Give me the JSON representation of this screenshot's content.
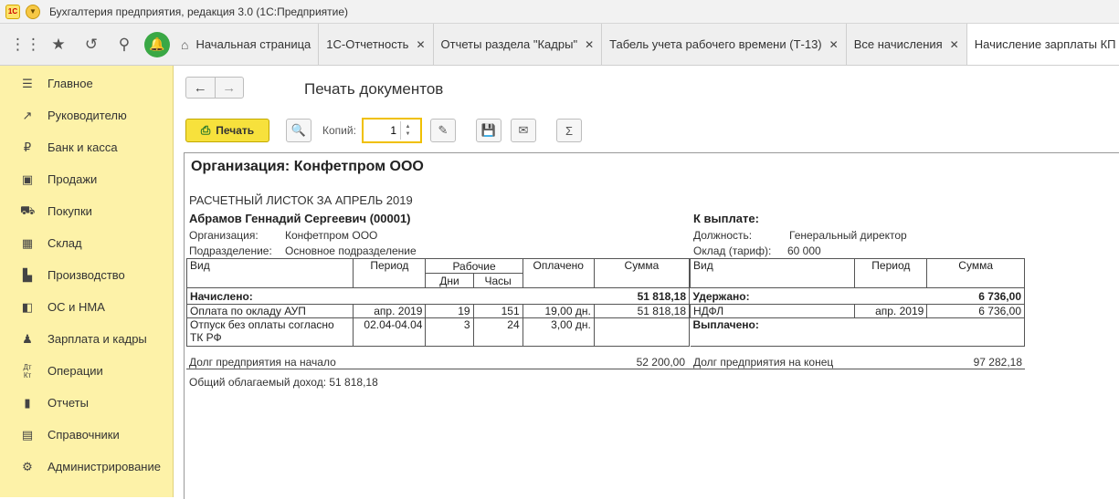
{
  "window": {
    "title": "Бухгалтерия предприятия, редакция 3.0  (1С:Предприятие)",
    "logo_text": "1С"
  },
  "tabs": [
    {
      "label": "Начальная страница",
      "closable": false
    },
    {
      "label": "1С-Отчетность",
      "closable": true
    },
    {
      "label": "Отчеты раздела \"Кадры\"",
      "closable": true
    },
    {
      "label": "Табель учета рабочего времени (Т-13)",
      "closable": true
    },
    {
      "label": "Все начисления",
      "closable": true
    },
    {
      "label": "Начисление зарплаты КП",
      "closable": false
    }
  ],
  "sidebar": {
    "items": [
      {
        "label": "Главное",
        "icon": "menu-icon"
      },
      {
        "label": "Руководителю",
        "icon": "trend-icon"
      },
      {
        "label": "Банк и касса",
        "icon": "ruble-icon"
      },
      {
        "label": "Продажи",
        "icon": "bag-icon"
      },
      {
        "label": "Покупки",
        "icon": "cart-icon"
      },
      {
        "label": "Склад",
        "icon": "warehouse-icon"
      },
      {
        "label": "Производство",
        "icon": "factory-icon"
      },
      {
        "label": "ОС и НМА",
        "icon": "truck-icon"
      },
      {
        "label": "Зарплата и кадры",
        "icon": "person-icon"
      },
      {
        "label": "Операции",
        "icon": "dt-kt-icon"
      },
      {
        "label": "Отчеты",
        "icon": "bar-chart-icon"
      },
      {
        "label": "Справочники",
        "icon": "book-icon"
      },
      {
        "label": "Администрирование",
        "icon": "gear-icon"
      }
    ]
  },
  "page": {
    "title": "Печать документов",
    "print_label": "Печать",
    "copies_label": "Копий:",
    "copies_value": "1"
  },
  "doc": {
    "org": "Организация: Конфетпром ООО",
    "sheet_title": "РАСЧЕТНЫЙ ЛИСТОК ЗА АПРЕЛЬ 2019",
    "employee": "Абрамов Геннадий Сергеевич (00001)",
    "to_pay": "К выплате:",
    "org_label": "Организация:",
    "org_value": "Конфетпром ООО",
    "dept_label": "Подразделение:",
    "dept_value": "Основное подразделение",
    "position_label": "Должность:",
    "position_value": "Генеральный директор",
    "salary_label": "Оклад (тариф):",
    "salary_value": "60 000",
    "headers": {
      "vid": "Вид",
      "period": "Период",
      "working": "Рабочие",
      "days": "Дни",
      "hours": "Часы",
      "paid": "Оплачено",
      "sum": "Сумма",
      "vid2": "Вид",
      "period2": "Период",
      "sum2": "Сумма"
    },
    "accrued_label": "Начислено:",
    "accrued_total": "51 818,18",
    "withheld_label": "Удержано:",
    "withheld_total": "6 736,00",
    "accruals": [
      {
        "name": "Оплата по окладу АУП",
        "period": "апр. 2019",
        "days": "19",
        "hours": "151",
        "paid": "19,00 дн.",
        "sum": "51 818,18"
      },
      {
        "name": "Отпуск без оплаты согласно",
        "name2": "ТК РФ",
        "period": "02.04-04.04",
        "days": "3",
        "hours": "24",
        "paid": "3,00 дн.",
        "sum": ""
      }
    ],
    "withholdings": [
      {
        "name": "НДФЛ",
        "period": "апр. 2019",
        "sum": "6 736,00"
      }
    ],
    "paid_out_label": "Выплачено:",
    "debt_start_label": "Долг предприятия на начало",
    "debt_start_value": "52 200,00",
    "debt_end_label": "Долг предприятия на конец",
    "debt_end_value": "97 282,18",
    "taxable_income": "Общий облагаемый доход: 51 818,18"
  }
}
